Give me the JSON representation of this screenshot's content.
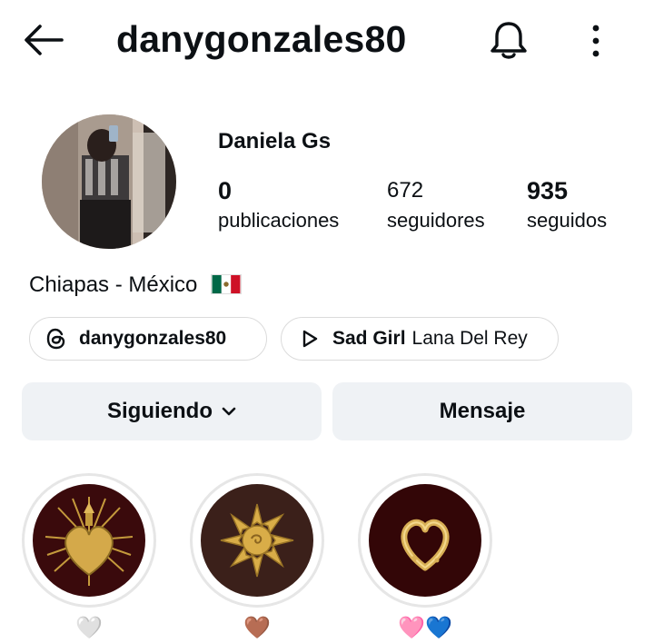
{
  "header": {
    "username": "danygonzales80",
    "back_icon": "arrow-left-icon",
    "notifications_icon": "bell-icon",
    "more_icon": "more-vertical-icon"
  },
  "profile": {
    "display_name": "Daniela Gs",
    "stats": {
      "posts": {
        "value": "0",
        "label": "publicaciones"
      },
      "followers": {
        "value": "672",
        "label": "seguidores"
      },
      "following": {
        "value": "935",
        "label": "seguidos"
      }
    },
    "bio_location": "Chiapas - México",
    "bio_flag": "mexico-flag-emoji"
  },
  "links": {
    "threads": {
      "icon": "threads-icon",
      "handle": "danygonzales80"
    },
    "music": {
      "icon": "play-icon",
      "song": "Sad Girl",
      "artist": "Lana Del Rey"
    }
  },
  "actions": {
    "follow_label": "Siguiendo",
    "message_label": "Mensaje"
  },
  "highlights": [
    {
      "caption": "🤍",
      "image": "sacred-heart"
    },
    {
      "caption": "🤎",
      "image": "gold-sun"
    },
    {
      "caption": "🩷💙",
      "image": "gold-heart"
    }
  ],
  "colors": {
    "button_bg": "#eff2f5",
    "highlight_ring": "#e6e6e6",
    "highlight_bg_dark": "#3a0a0c"
  }
}
